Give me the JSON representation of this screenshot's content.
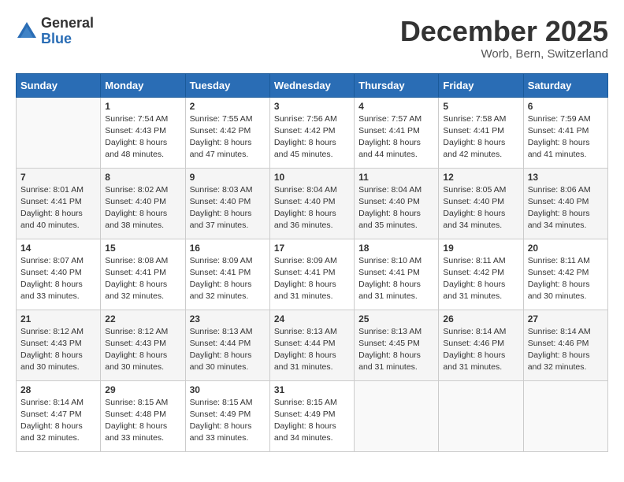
{
  "header": {
    "logo_line1": "General",
    "logo_line2": "Blue",
    "title": "December 2025",
    "subtitle": "Worb, Bern, Switzerland"
  },
  "days_of_week": [
    "Sunday",
    "Monday",
    "Tuesday",
    "Wednesday",
    "Thursday",
    "Friday",
    "Saturday"
  ],
  "weeks": [
    [
      {
        "day": "",
        "info": ""
      },
      {
        "day": "1",
        "info": "Sunrise: 7:54 AM\nSunset: 4:43 PM\nDaylight: 8 hours\nand 48 minutes."
      },
      {
        "day": "2",
        "info": "Sunrise: 7:55 AM\nSunset: 4:42 PM\nDaylight: 8 hours\nand 47 minutes."
      },
      {
        "day": "3",
        "info": "Sunrise: 7:56 AM\nSunset: 4:42 PM\nDaylight: 8 hours\nand 45 minutes."
      },
      {
        "day": "4",
        "info": "Sunrise: 7:57 AM\nSunset: 4:41 PM\nDaylight: 8 hours\nand 44 minutes."
      },
      {
        "day": "5",
        "info": "Sunrise: 7:58 AM\nSunset: 4:41 PM\nDaylight: 8 hours\nand 42 minutes."
      },
      {
        "day": "6",
        "info": "Sunrise: 7:59 AM\nSunset: 4:41 PM\nDaylight: 8 hours\nand 41 minutes."
      }
    ],
    [
      {
        "day": "7",
        "info": "Sunrise: 8:01 AM\nSunset: 4:41 PM\nDaylight: 8 hours\nand 40 minutes."
      },
      {
        "day": "8",
        "info": "Sunrise: 8:02 AM\nSunset: 4:40 PM\nDaylight: 8 hours\nand 38 minutes."
      },
      {
        "day": "9",
        "info": "Sunrise: 8:03 AM\nSunset: 4:40 PM\nDaylight: 8 hours\nand 37 minutes."
      },
      {
        "day": "10",
        "info": "Sunrise: 8:04 AM\nSunset: 4:40 PM\nDaylight: 8 hours\nand 36 minutes."
      },
      {
        "day": "11",
        "info": "Sunrise: 8:04 AM\nSunset: 4:40 PM\nDaylight: 8 hours\nand 35 minutes."
      },
      {
        "day": "12",
        "info": "Sunrise: 8:05 AM\nSunset: 4:40 PM\nDaylight: 8 hours\nand 34 minutes."
      },
      {
        "day": "13",
        "info": "Sunrise: 8:06 AM\nSunset: 4:40 PM\nDaylight: 8 hours\nand 34 minutes."
      }
    ],
    [
      {
        "day": "14",
        "info": "Sunrise: 8:07 AM\nSunset: 4:40 PM\nDaylight: 8 hours\nand 33 minutes."
      },
      {
        "day": "15",
        "info": "Sunrise: 8:08 AM\nSunset: 4:41 PM\nDaylight: 8 hours\nand 32 minutes."
      },
      {
        "day": "16",
        "info": "Sunrise: 8:09 AM\nSunset: 4:41 PM\nDaylight: 8 hours\nand 32 minutes."
      },
      {
        "day": "17",
        "info": "Sunrise: 8:09 AM\nSunset: 4:41 PM\nDaylight: 8 hours\nand 31 minutes."
      },
      {
        "day": "18",
        "info": "Sunrise: 8:10 AM\nSunset: 4:41 PM\nDaylight: 8 hours\nand 31 minutes."
      },
      {
        "day": "19",
        "info": "Sunrise: 8:11 AM\nSunset: 4:42 PM\nDaylight: 8 hours\nand 31 minutes."
      },
      {
        "day": "20",
        "info": "Sunrise: 8:11 AM\nSunset: 4:42 PM\nDaylight: 8 hours\nand 30 minutes."
      }
    ],
    [
      {
        "day": "21",
        "info": "Sunrise: 8:12 AM\nSunset: 4:43 PM\nDaylight: 8 hours\nand 30 minutes."
      },
      {
        "day": "22",
        "info": "Sunrise: 8:12 AM\nSunset: 4:43 PM\nDaylight: 8 hours\nand 30 minutes."
      },
      {
        "day": "23",
        "info": "Sunrise: 8:13 AM\nSunset: 4:44 PM\nDaylight: 8 hours\nand 30 minutes."
      },
      {
        "day": "24",
        "info": "Sunrise: 8:13 AM\nSunset: 4:44 PM\nDaylight: 8 hours\nand 31 minutes."
      },
      {
        "day": "25",
        "info": "Sunrise: 8:13 AM\nSunset: 4:45 PM\nDaylight: 8 hours\nand 31 minutes."
      },
      {
        "day": "26",
        "info": "Sunrise: 8:14 AM\nSunset: 4:46 PM\nDaylight: 8 hours\nand 31 minutes."
      },
      {
        "day": "27",
        "info": "Sunrise: 8:14 AM\nSunset: 4:46 PM\nDaylight: 8 hours\nand 32 minutes."
      }
    ],
    [
      {
        "day": "28",
        "info": "Sunrise: 8:14 AM\nSunset: 4:47 PM\nDaylight: 8 hours\nand 32 minutes."
      },
      {
        "day": "29",
        "info": "Sunrise: 8:15 AM\nSunset: 4:48 PM\nDaylight: 8 hours\nand 33 minutes."
      },
      {
        "day": "30",
        "info": "Sunrise: 8:15 AM\nSunset: 4:49 PM\nDaylight: 8 hours\nand 33 minutes."
      },
      {
        "day": "31",
        "info": "Sunrise: 8:15 AM\nSunset: 4:49 PM\nDaylight: 8 hours\nand 34 minutes."
      },
      {
        "day": "",
        "info": ""
      },
      {
        "day": "",
        "info": ""
      },
      {
        "day": "",
        "info": ""
      }
    ]
  ]
}
